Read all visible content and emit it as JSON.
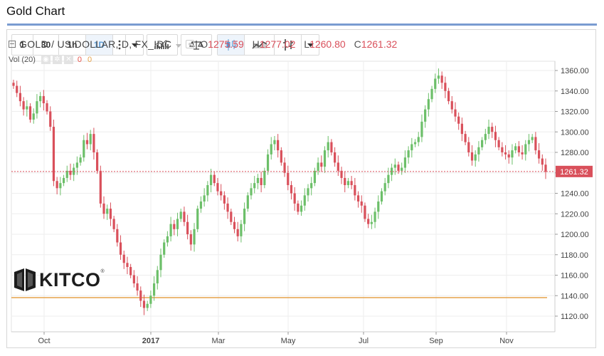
{
  "page": {
    "title": "Gold Chart"
  },
  "toolbar": {
    "intervals": [
      "1",
      "30",
      "1h",
      "1D"
    ],
    "active_interval": "1D"
  },
  "legend": {
    "symbol": "GOLD / US DOLLAR, D, FX_IDC",
    "o_label": "O",
    "o_value": "1275.59",
    "h_label": "H",
    "h_value": "1277.02",
    "l_label": "L",
    "l_value": "1260.80",
    "c_label": "C",
    "c_value": "1261.32",
    "vol_label": "Vol (20)",
    "vol_value1": "0",
    "vol_value2": "0"
  },
  "logo": {
    "text": "KITCO",
    "reg": "®"
  },
  "colors": {
    "up": "#6cbf69",
    "down": "#d9505b",
    "grid": "#eeeeee",
    "axis_text": "#444444",
    "price_line": "#d9505b",
    "price_label_bg": "#d9505b",
    "volume_line": "#e6a24a",
    "active_button": "#5b9bd5"
  },
  "chart_data": {
    "type": "candlestick",
    "title": "GOLD / US DOLLAR, D, FX_IDC",
    "ylim": [
      1105,
      1370
    ],
    "y_ticks": [
      "1360.00",
      "1340.00",
      "1320.00",
      "1300.00",
      "1280.00",
      "1260.00",
      "1240.00",
      "1220.00",
      "1200.00",
      "1180.00",
      "1160.00",
      "1140.00",
      "1120.00"
    ],
    "x_ticks": [
      "Oct",
      "2017",
      "Mar",
      "May",
      "Jul",
      "Sep",
      "Nov"
    ],
    "last_price": 1261.32,
    "last_price_label": "1261.32",
    "volume_value": 0,
    "grid": true,
    "close_series": [
      1345,
      1338,
      1330,
      1322,
      1325,
      1312,
      1318,
      1330,
      1335,
      1328,
      1320,
      1305,
      1252,
      1245,
      1250,
      1255,
      1262,
      1258,
      1265,
      1270,
      1275,
      1292,
      1288,
      1298,
      1280,
      1262,
      1230,
      1220,
      1225,
      1215,
      1205,
      1192,
      1180,
      1172,
      1168,
      1160,
      1152,
      1145,
      1135,
      1128,
      1132,
      1140,
      1152,
      1165,
      1180,
      1192,
      1198,
      1210,
      1205,
      1215,
      1222,
      1212,
      1200,
      1190,
      1205,
      1225,
      1232,
      1238,
      1248,
      1258,
      1250,
      1242,
      1238,
      1230,
      1222,
      1212,
      1205,
      1198,
      1210,
      1225,
      1238,
      1245,
      1250,
      1255,
      1248,
      1262,
      1278,
      1288,
      1292,
      1282,
      1270,
      1260,
      1248,
      1240,
      1230,
      1222,
      1228,
      1238,
      1245,
      1250,
      1262,
      1270,
      1266,
      1282,
      1290,
      1280,
      1270,
      1262,
      1255,
      1248,
      1252,
      1248,
      1238,
      1232,
      1228,
      1215,
      1210,
      1212,
      1222,
      1232,
      1242,
      1250,
      1258,
      1265,
      1268,
      1262,
      1265,
      1275,
      1282,
      1288,
      1290,
      1295,
      1310,
      1322,
      1332,
      1342,
      1352,
      1355,
      1348,
      1340,
      1330,
      1322,
      1315,
      1308,
      1298,
      1290,
      1280,
      1272,
      1278,
      1285,
      1292,
      1298,
      1305,
      1300,
      1292,
      1285,
      1280,
      1278,
      1275,
      1282,
      1286,
      1280,
      1278,
      1288,
      1292,
      1295,
      1282,
      1274,
      1268,
      1261
    ]
  }
}
